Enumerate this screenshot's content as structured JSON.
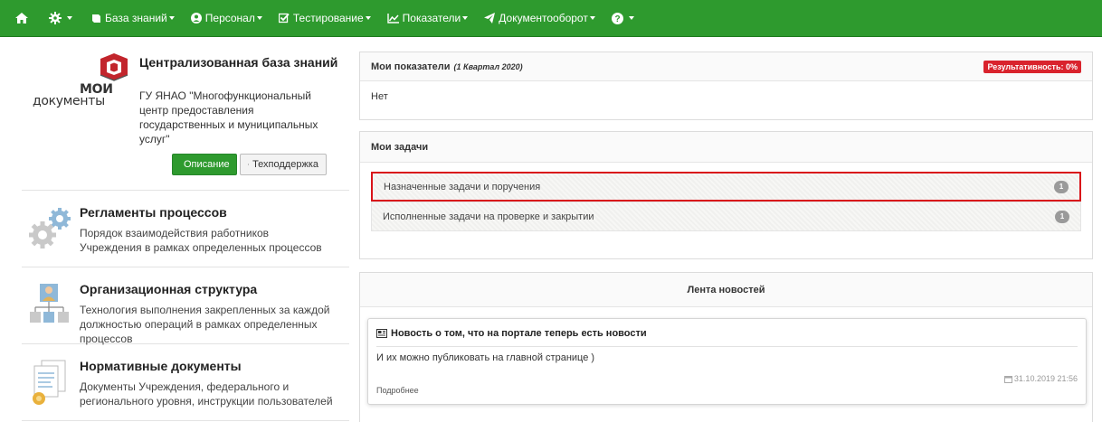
{
  "navbar": {
    "items": [
      {
        "label": "База знаний"
      },
      {
        "label": "Персонал"
      },
      {
        "label": "Тестирование"
      },
      {
        "label": "Показатели"
      },
      {
        "label": "Документооборот"
      }
    ]
  },
  "brand": {
    "logo_line1": "МОИ",
    "logo_line2": "документы",
    "portal_title": "Централизованная база знаний",
    "org_name": "ГУ ЯНАО \"Многофункциональный центр предоставления государственных и муниципальных услуг\"",
    "btn_description": "Описание",
    "btn_support": "Техподдержка"
  },
  "sections": [
    {
      "title": "Регламенты процессов",
      "desc": "Порядок взаимодействия работников Учреждения в рамках определенных процессов"
    },
    {
      "title": "Организационная структура",
      "desc": "Технология выполнения закрепленных за каждой должностью операций в рамках определенных процессов"
    },
    {
      "title": "Нормативные документы",
      "desc": "Документы Учреждения, федерального и регионального уровня, инструкции пользователей"
    }
  ],
  "metrics": {
    "title": "Мои показатели",
    "period": "(1 Квартал 2020)",
    "badge": "Результативность: 0%",
    "body": "Нет"
  },
  "tasks": {
    "title": "Мои задачи",
    "items": [
      {
        "label": "Назначенные задачи и поручения",
        "count": "1"
      },
      {
        "label": "Исполненные задачи на проверке и закрытии",
        "count": "1"
      }
    ]
  },
  "news": {
    "title": "Лента новостей",
    "item_title": "Новость о том, что на портале теперь есть новости",
    "item_text": "И их можно публиковать на главной странице )",
    "item_date": "31.10.2019 21:56",
    "item_more": "Подробнее"
  },
  "colors": {
    "navbar_green": "#2e9a2e",
    "badge_red": "#d9232d",
    "highlight_red": "#d9141a"
  }
}
